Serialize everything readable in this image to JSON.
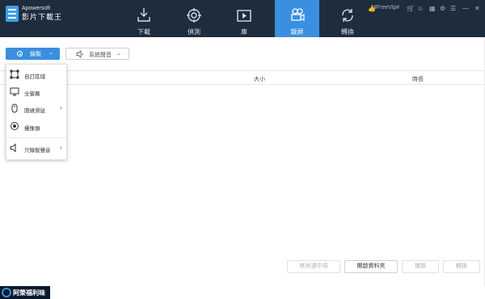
{
  "app": {
    "brand_small": "Apowersoft",
    "brand_name": "影片下載王"
  },
  "nav": {
    "tabs": [
      {
        "label": "下載",
        "icon": "download-icon"
      },
      {
        "label": "偵測",
        "icon": "detect-icon"
      },
      {
        "label": "庫",
        "icon": "library-icon"
      },
      {
        "label": "錄屏",
        "icon": "record-screen-icon"
      },
      {
        "label": "轉換",
        "icon": "convert-icon"
      }
    ]
  },
  "window_controls": {
    "freevip": "#FreeVip#"
  },
  "toolbar": {
    "record_label": "錄製",
    "audio_label": "系統聲音"
  },
  "table": {
    "headers": [
      "大小",
      "時長"
    ]
  },
  "record_menu": {
    "items": [
      {
        "label": "自訂區域",
        "icon": "region-icon"
      },
      {
        "label": "全螢幕",
        "icon": "monitor-icon"
      },
      {
        "label": "圍繞滑鼠",
        "icon": "mouse-icon"
      },
      {
        "label": "攝像頭",
        "icon": "webcam-icon"
      },
      {
        "label": "只錄製聲音",
        "icon": "audio-icon"
      }
    ]
  },
  "bottom": {
    "remove_label": "移除選中項",
    "open_folder_label": "開啟資料夾",
    "play_label": "播放",
    "convert_label": "轉換"
  },
  "watermark": {
    "text": "阿榮福利味"
  },
  "colors": {
    "titlebar": "#1e2d3d",
    "accent": "#3a8fe0"
  }
}
